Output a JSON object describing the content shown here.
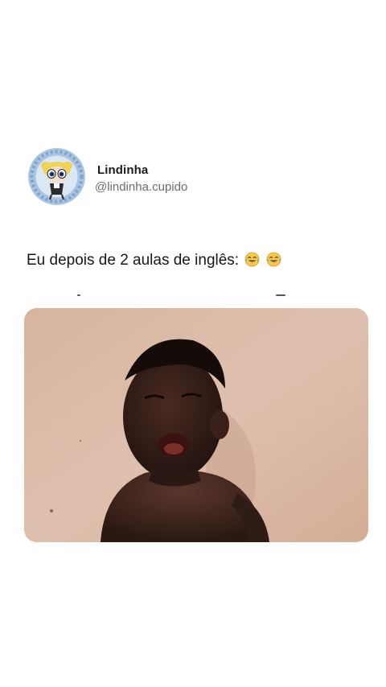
{
  "post": {
    "author_name": "Lindinha",
    "author_handle": "@lindinha.cupido",
    "text": "Eu depois de 2 aulas de inglês:",
    "emojis": [
      "face-with-tears-of-joy-icon",
      "face-with-tears-of-joy-icon"
    ]
  },
  "colors": {
    "background": "#ffffff",
    "avatar_ring": "#a9c3e0",
    "name": "#1c1c1c",
    "handle": "#6c6c6c",
    "media_wall": "#d9b6a3"
  }
}
